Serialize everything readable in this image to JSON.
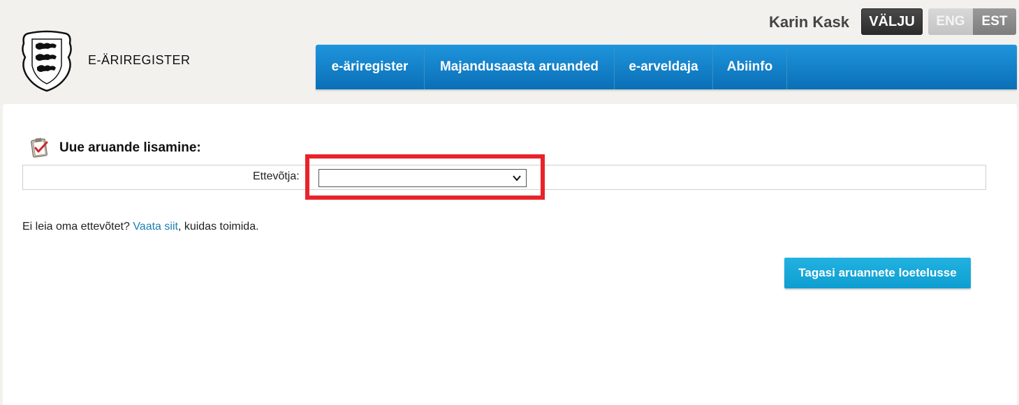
{
  "header": {
    "brand": "E-ÄRIREGISTER",
    "user_name": "Karin Kask",
    "logout_label": "VÄLJU",
    "languages": [
      {
        "label": "ENG",
        "active": false
      },
      {
        "label": "EST",
        "active": true
      }
    ]
  },
  "nav": {
    "items": [
      {
        "label": "e-äriregister"
      },
      {
        "label": "Majandusaasta aruanded"
      },
      {
        "label": "e-arveldaja"
      },
      {
        "label": "Abiinfo"
      }
    ]
  },
  "main": {
    "section_title": "Uue aruande lisamine:",
    "form": {
      "company_label": "Ettevõtja:",
      "company_value": ""
    },
    "help": {
      "prefix": "Ei leia oma ettevõtet? ",
      "link_text": "Vaata siit",
      "suffix": ", kuidas toimida."
    },
    "back_button_label": "Tagasi aruannete loetelusse"
  },
  "colors": {
    "nav_blue": "#0a6fb7",
    "button_cyan": "#0e9ed1",
    "highlight_red": "#e8232a",
    "link_blue": "#1a7fb0"
  }
}
